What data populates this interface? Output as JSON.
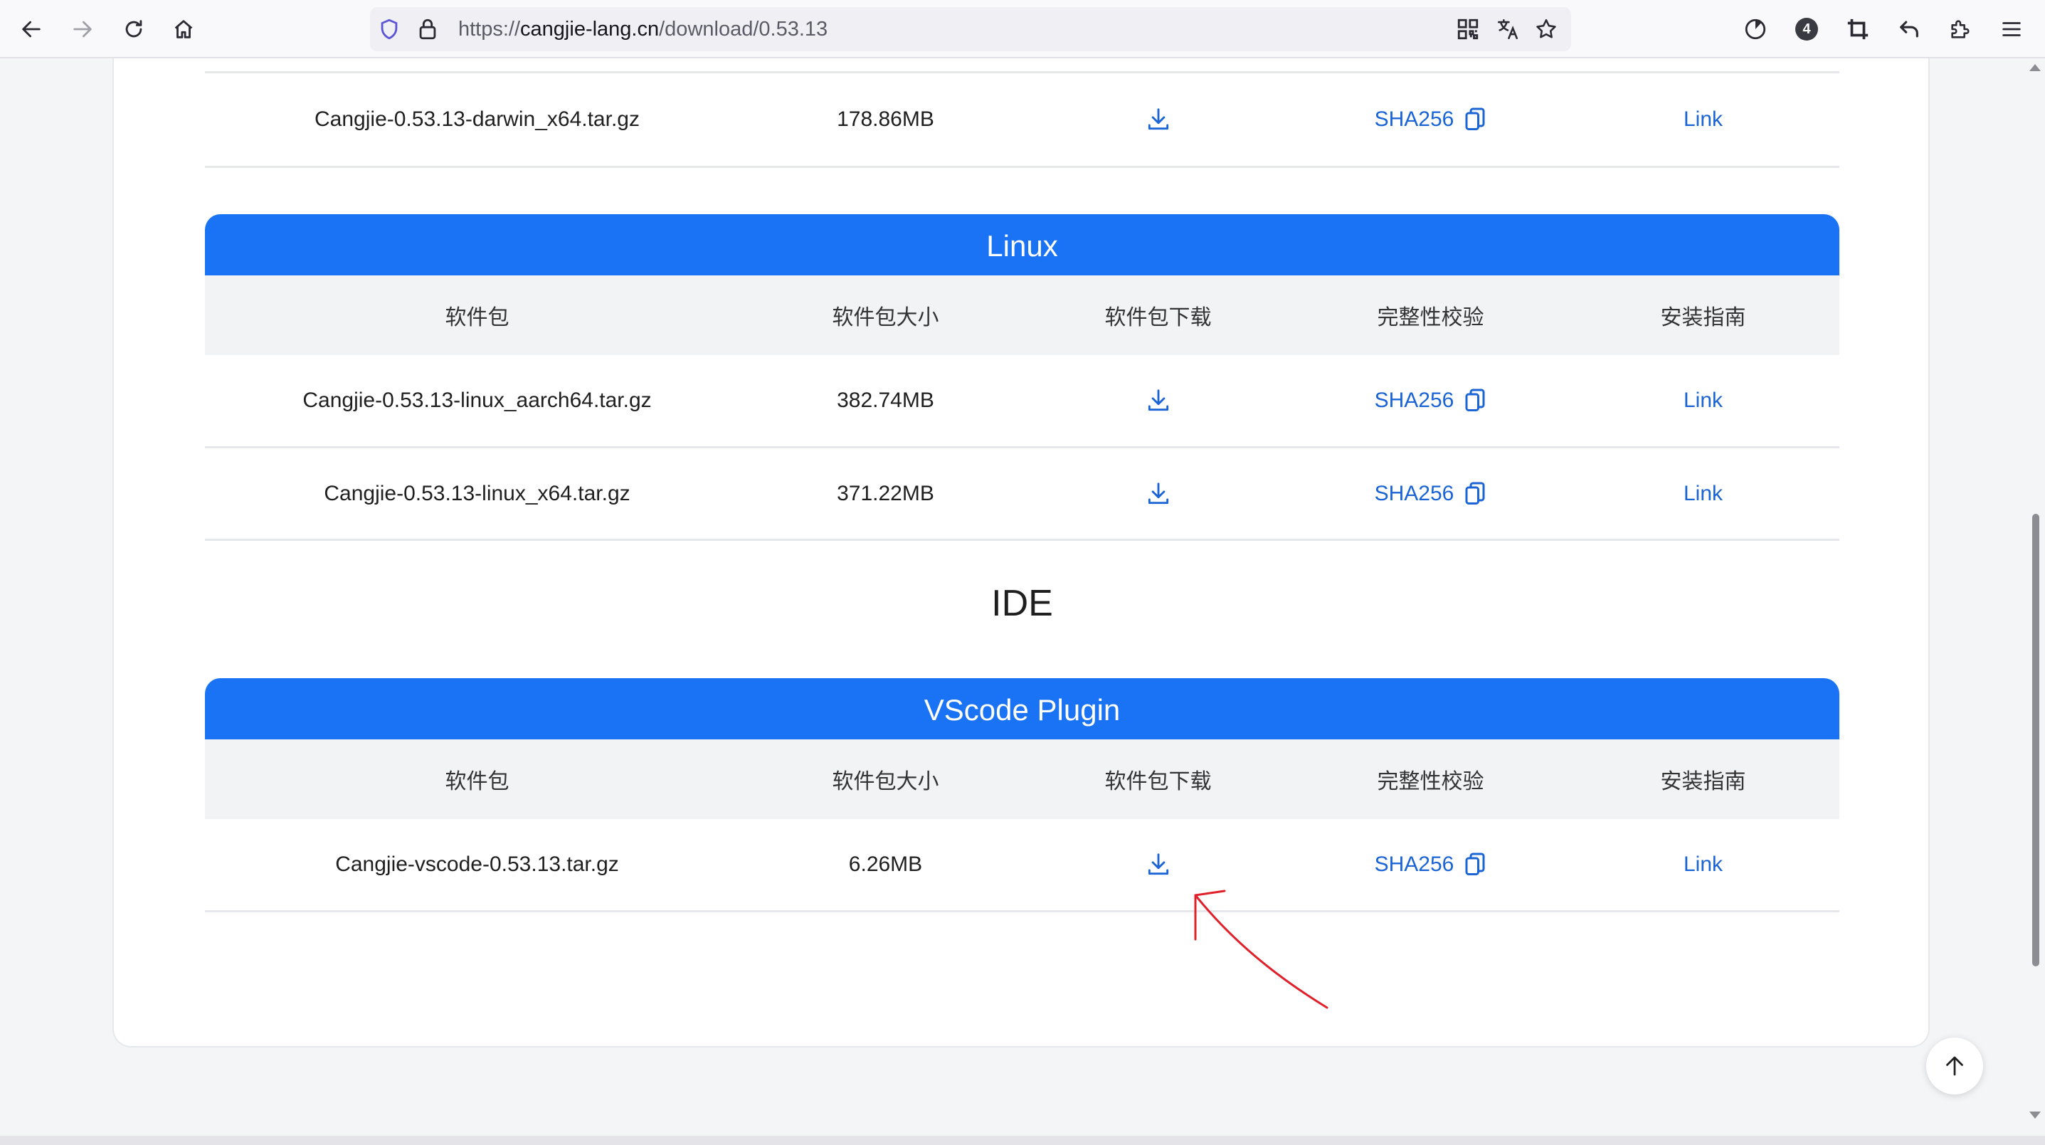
{
  "browser": {
    "url_scheme": "https://",
    "url_host": "cangjie-lang.cn",
    "url_path": "/download/0.53.13",
    "badge_count": "4"
  },
  "table_columns": [
    "软件包",
    "软件包大小",
    "软件包下载",
    "完整性校验",
    "安装指南"
  ],
  "sections": {
    "top_partial": {
      "rows": [
        {
          "package": "Cangjie-0.53.13-darwin_x64.tar.gz",
          "size": "178.86MB",
          "checksum": "SHA256",
          "guide": "Link"
        }
      ]
    },
    "linux": {
      "title": "Linux",
      "rows": [
        {
          "package": "Cangjie-0.53.13-linux_aarch64.tar.gz",
          "size": "382.74MB",
          "checksum": "SHA256",
          "guide": "Link"
        },
        {
          "package": "Cangjie-0.53.13-linux_x64.tar.gz",
          "size": "371.22MB",
          "checksum": "SHA256",
          "guide": "Link"
        }
      ]
    },
    "ide": {
      "heading": "IDE"
    },
    "vscode": {
      "title": "VScode Plugin",
      "rows": [
        {
          "package": "Cangjie-vscode-0.53.13.tar.gz",
          "size": "6.26MB",
          "checksum": "SHA256",
          "guide": "Link"
        }
      ]
    }
  },
  "icons": {
    "download": "download-icon",
    "copy": "copy-icon",
    "back_to_top": "arrow-up-icon"
  },
  "colors": {
    "accent": "#1a73f5",
    "link": "#1a64d6",
    "annotation": "#e0202a"
  }
}
